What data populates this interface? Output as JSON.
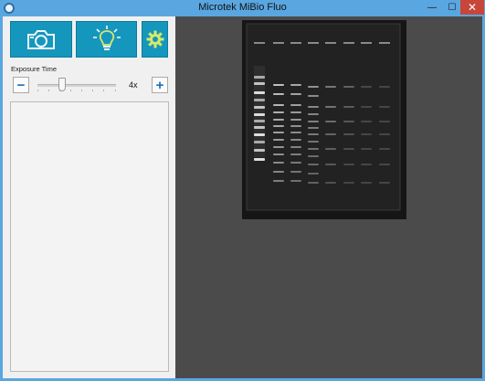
{
  "window": {
    "title": "Microtek MiBio Fluo",
    "minimize_glyph": "—",
    "maximize_glyph": "☐",
    "close_glyph": "✕"
  },
  "toolbar": {
    "capture_icon": "camera-icon",
    "light_icon": "lightbulb-icon",
    "settings_icon": "gear-icon",
    "accent_color": "#1597bd"
  },
  "exposure": {
    "label": "Exposure Time",
    "value": "4x",
    "minus_label": "−",
    "plus_label": "+",
    "slider_level": 0.31
  },
  "preview": {
    "lanes": 8,
    "background_color": "#4b4b4b"
  }
}
